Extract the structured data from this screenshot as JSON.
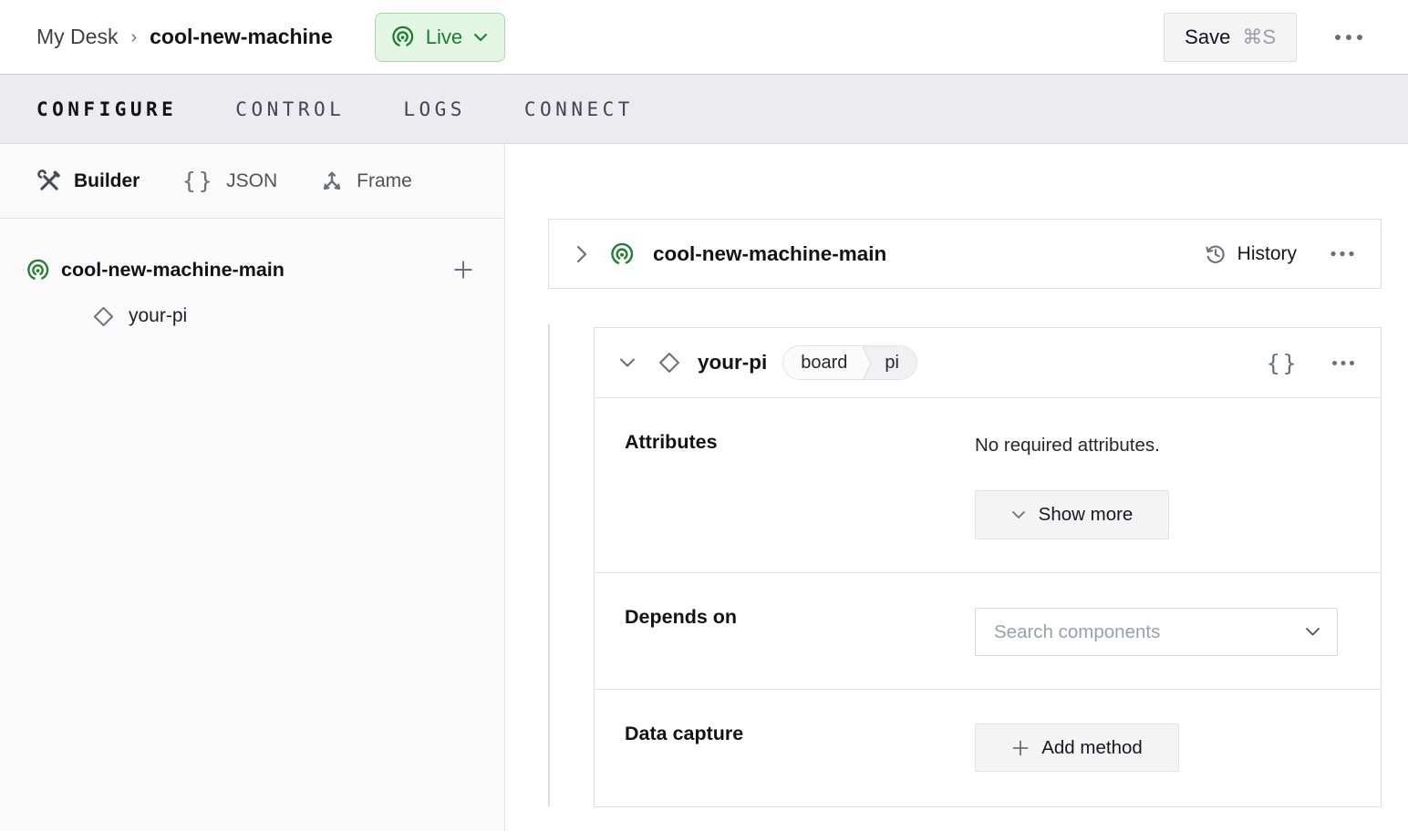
{
  "header": {
    "breadcrumb": {
      "parent": "My Desk",
      "separator": "›",
      "current": "cool-new-machine"
    },
    "live_badge": {
      "label": "Live"
    },
    "save_button": {
      "label": "Save",
      "shortcut": "⌘S"
    }
  },
  "tabs": [
    {
      "label": "CONFIGURE",
      "active": true
    },
    {
      "label": "CONTROL",
      "active": false
    },
    {
      "label": "LOGS",
      "active": false
    },
    {
      "label": "CONNECT",
      "active": false
    }
  ],
  "sidebar": {
    "modes": [
      {
        "label": "Builder",
        "icon": "tools-icon",
        "active": true
      },
      {
        "label": "JSON",
        "icon": "braces-icon",
        "active": false
      },
      {
        "label": "Frame",
        "icon": "axes-icon",
        "active": false
      }
    ],
    "tree": {
      "root": {
        "name": "cool-new-machine-main"
      },
      "children": [
        {
          "name": "your-pi"
        }
      ]
    }
  },
  "main": {
    "machine_card": {
      "title": "cool-new-machine-main",
      "history_label": "History"
    },
    "component_card": {
      "title": "your-pi",
      "type_badge": {
        "type": "board",
        "model": "pi"
      },
      "attributes": {
        "label": "Attributes",
        "empty_message": "No required attributes.",
        "show_more_label": "Show more"
      },
      "depends_on": {
        "label": "Depends on",
        "placeholder": "Search components"
      },
      "data_capture": {
        "label": "Data capture",
        "add_method_label": "Add method"
      }
    }
  },
  "icons": {
    "braces_glyph": "{}"
  },
  "colors": {
    "accent_green": "#267E36",
    "live_bg": "#E3F6E3",
    "live_border": "#A6D7A8",
    "live_text": "#1B7C30",
    "tabbar_bg": "#ECECF0",
    "sidebar_bg": "#FAFAFA",
    "border_light": "#DFDFE2"
  }
}
